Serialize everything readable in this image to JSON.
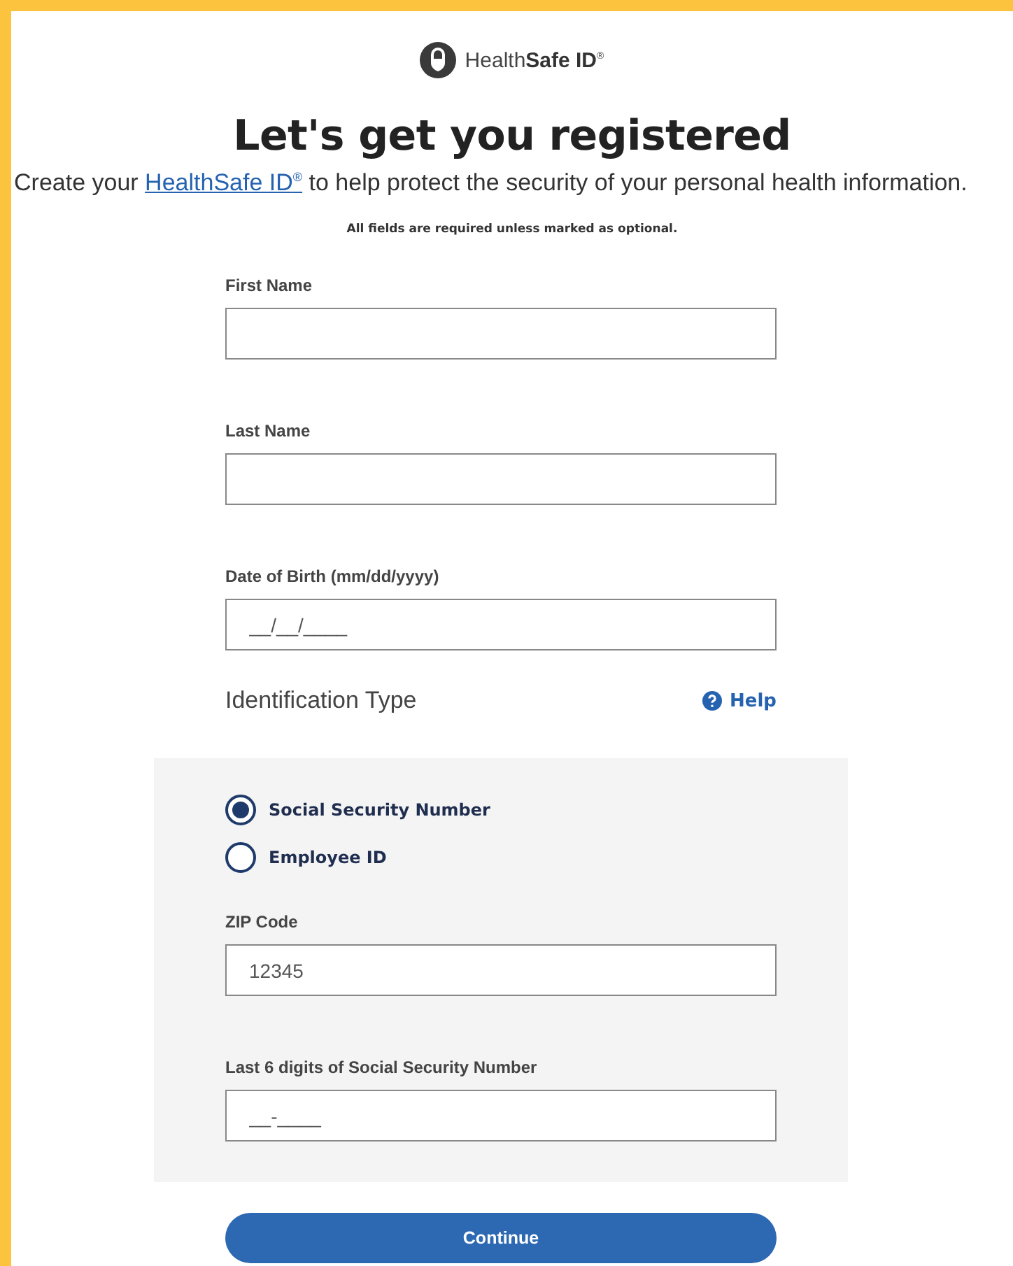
{
  "logo": {
    "text": "Health**Safe ID**$^{®}$"
  },
  "heading": "Let's get you registered",
  "subtitle": {
    "before": "Create your ",
    "link": "HealthSafe ID$^{®}$",
    "after": " to help protect the security of your personal health information."
  },
  "note": "All fields are required unless marked as optional.",
  "fields": [
    {
      "label": "First Name"
    },
    {
      "label": "Last Name"
    },
    {
      "label": "Date of Birth (mm/dd/yyyy)",
      "placeholder": "__/__/____"
    }
  ],
  "identification": {
    "title": "Identification Type",
    "help": "Help",
    "options": [
      {
        "label": "Social Security Number",
        "selected": true
      },
      {
        "label": "Employee ID",
        "selected": false
      }
    ],
    "fields": [
      {
        "label": "ZIP Code",
        "placeholder": "12345"
      },
      {
        "label": "Last 6 digits of Social Security Number",
        "placeholder": "__-____"
      }
    ]
  },
  "button": "Continue"
}
